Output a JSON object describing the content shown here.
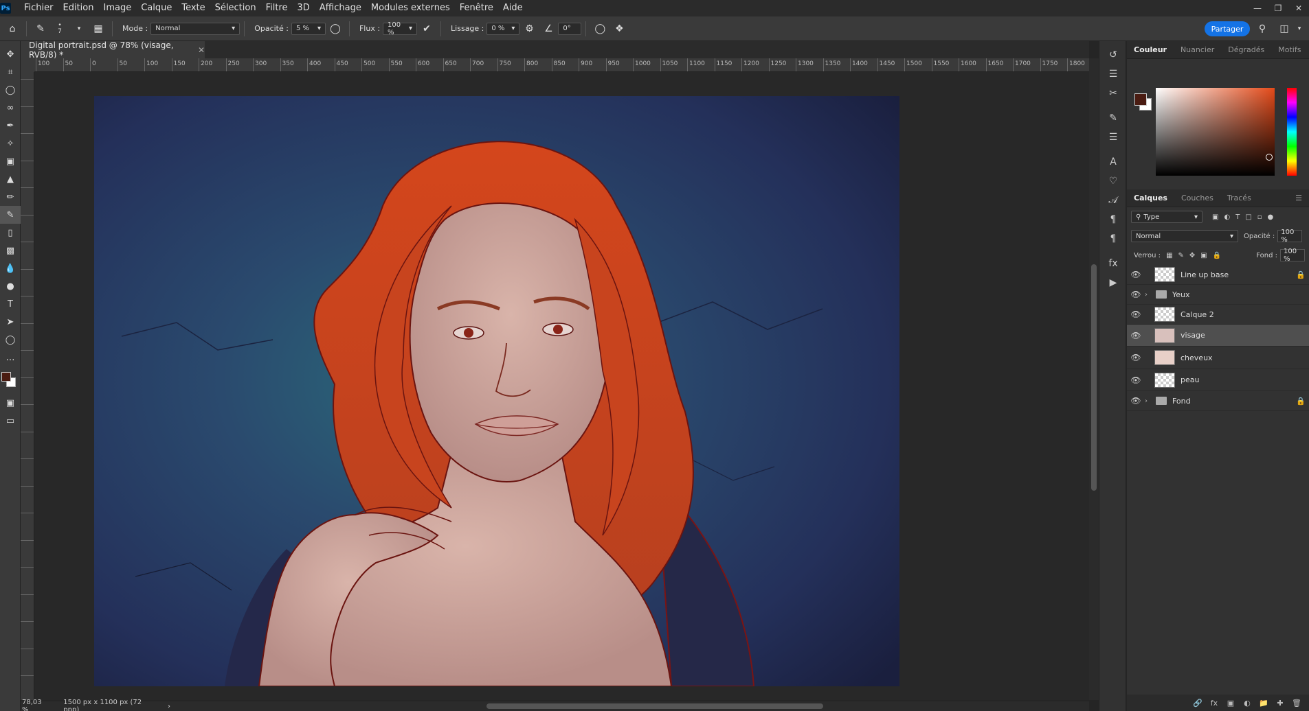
{
  "menu": [
    "Fichier",
    "Edition",
    "Image",
    "Calque",
    "Texte",
    "Sélection",
    "Filtre",
    "3D",
    "Affichage",
    "Modules externes",
    "Fenêtre",
    "Aide"
  ],
  "options": {
    "brush_size": "7",
    "mode_label": "Mode :",
    "mode_value": "Normal",
    "opacity_label": "Opacité :",
    "opacity_value": "5 %",
    "flow_label": "Flux :",
    "flow_value": "100 %",
    "smoothing_label": "Lissage :",
    "smoothing_value": "0 %",
    "angle_value": "0°",
    "share_label": "Partager"
  },
  "document": {
    "tab_title": "Digital portrait.psd @ 78% (visage, RVB/8) *"
  },
  "status": {
    "zoom": "78,03 %",
    "doc_size": "1500 px x 1100 px (72 ppp)"
  },
  "ruler_labels": [
    "100",
    "50",
    "0",
    "50",
    "100",
    "150",
    "200",
    "250",
    "300",
    "350",
    "400",
    "450",
    "500",
    "550",
    "600",
    "650",
    "700",
    "750",
    "800",
    "850",
    "900",
    "950",
    "1000",
    "1050",
    "1100",
    "1150",
    "1200",
    "1250",
    "1300",
    "1350",
    "1400",
    "1450",
    "1500",
    "1550",
    "1600",
    "1650",
    "1700",
    "1750",
    "1800"
  ],
  "color_panel": {
    "tabs": [
      "Couleur",
      "Nuancier",
      "Dégradés",
      "Motifs"
    ],
    "foreground": "#4a1c12",
    "background": "#ffffff"
  },
  "layers_panel": {
    "tabs": [
      "Calques",
      "Couches",
      "Tracés"
    ],
    "filter_value": "Type",
    "blend_value": "Normal",
    "opacity_label": "Opacité :",
    "opacity_value": "100 %",
    "lock_label": "Verrou :",
    "fill_label": "Fond :",
    "fill_value": "100 %",
    "layers": [
      {
        "name": "Line up base",
        "type": "layer",
        "locked": true,
        "selected": false
      },
      {
        "name": "Yeux",
        "type": "group",
        "locked": false,
        "selected": false
      },
      {
        "name": "Calque 2",
        "type": "layer",
        "locked": false,
        "selected": false
      },
      {
        "name": "visage",
        "type": "layer",
        "locked": false,
        "selected": true
      },
      {
        "name": "cheveux",
        "type": "layer",
        "locked": false,
        "selected": false
      },
      {
        "name": "peau",
        "type": "layer",
        "locked": false,
        "selected": false
      },
      {
        "name": "Fond",
        "type": "group",
        "locked": true,
        "selected": false
      }
    ]
  }
}
